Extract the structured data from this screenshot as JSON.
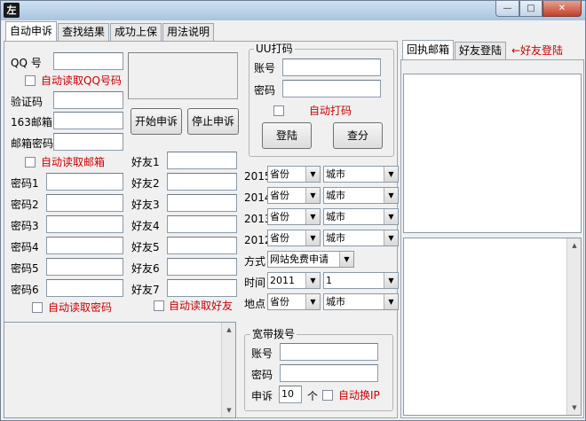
{
  "window": {
    "icon_text": "左",
    "controls": {
      "min": "—",
      "max": "□",
      "close": "✕"
    }
  },
  "tabs": [
    {
      "label": "自动申诉"
    },
    {
      "label": "查找结果"
    },
    {
      "label": "成功上保"
    },
    {
      "label": "用法说明"
    }
  ],
  "left": {
    "qq_label": "QQ 号",
    "qq_value": "",
    "auto_qq_label": "自动读取QQ号码",
    "verify_label": "验证码",
    "verify_value": "",
    "mail163_label": "163邮箱",
    "mail163_value": "",
    "mailpwd_label": "邮箱密码",
    "mailpwd_value": "",
    "start_button": "开始申诉",
    "stop_button": "停止申诉",
    "auto_mail_label": "自动读取邮箱",
    "passwords": [
      {
        "label": "密码1",
        "value": ""
      },
      {
        "label": "密码2",
        "value": ""
      },
      {
        "label": "密码3",
        "value": ""
      },
      {
        "label": "密码4",
        "value": ""
      },
      {
        "label": "密码5",
        "value": ""
      },
      {
        "label": "密码6",
        "value": ""
      }
    ],
    "friends": [
      {
        "label": "好友1",
        "value": ""
      },
      {
        "label": "好友2",
        "value": ""
      },
      {
        "label": "好友3",
        "value": ""
      },
      {
        "label": "好友4",
        "value": ""
      },
      {
        "label": "好友5",
        "value": ""
      },
      {
        "label": "好友6",
        "value": ""
      },
      {
        "label": "好友7",
        "value": ""
      }
    ],
    "auto_pwd_label": "自动读取密码",
    "auto_friend_label": "自动读取好友"
  },
  "uu": {
    "title": "UU打码",
    "account_label": "账号",
    "account_value": "",
    "password_label": "密码",
    "password_value": "",
    "auto_label": "自动打码",
    "login_button": "登陆",
    "query_button": "查分"
  },
  "years": [
    {
      "year": "2015",
      "province": "省份",
      "city": "城市"
    },
    {
      "year": "2014",
      "province": "省份",
      "city": "城市"
    },
    {
      "year": "2013",
      "province": "省份",
      "city": "城市"
    },
    {
      "year": "2012",
      "province": "省份",
      "city": "城市"
    }
  ],
  "method": {
    "label": "方式",
    "value": "网站免费申请"
  },
  "time": {
    "label": "时间",
    "year": "2011",
    "month": "1"
  },
  "location": {
    "label": "地点",
    "province": "省份",
    "city": "城市"
  },
  "broadband": {
    "title": "宽带拨号",
    "account_label": "账号",
    "account_value": "",
    "password_label": "密码",
    "password_value": "",
    "appeal_label": "申诉",
    "appeal_count": "10",
    "unit": "个",
    "auto_ip_label": "自动换IP"
  },
  "right": {
    "tabs": [
      {
        "label": "回执邮箱"
      },
      {
        "label": "好友登陆"
      }
    ],
    "extra_label": "←好友登陆"
  },
  "colors": {
    "accent_red": "#cc0000"
  }
}
